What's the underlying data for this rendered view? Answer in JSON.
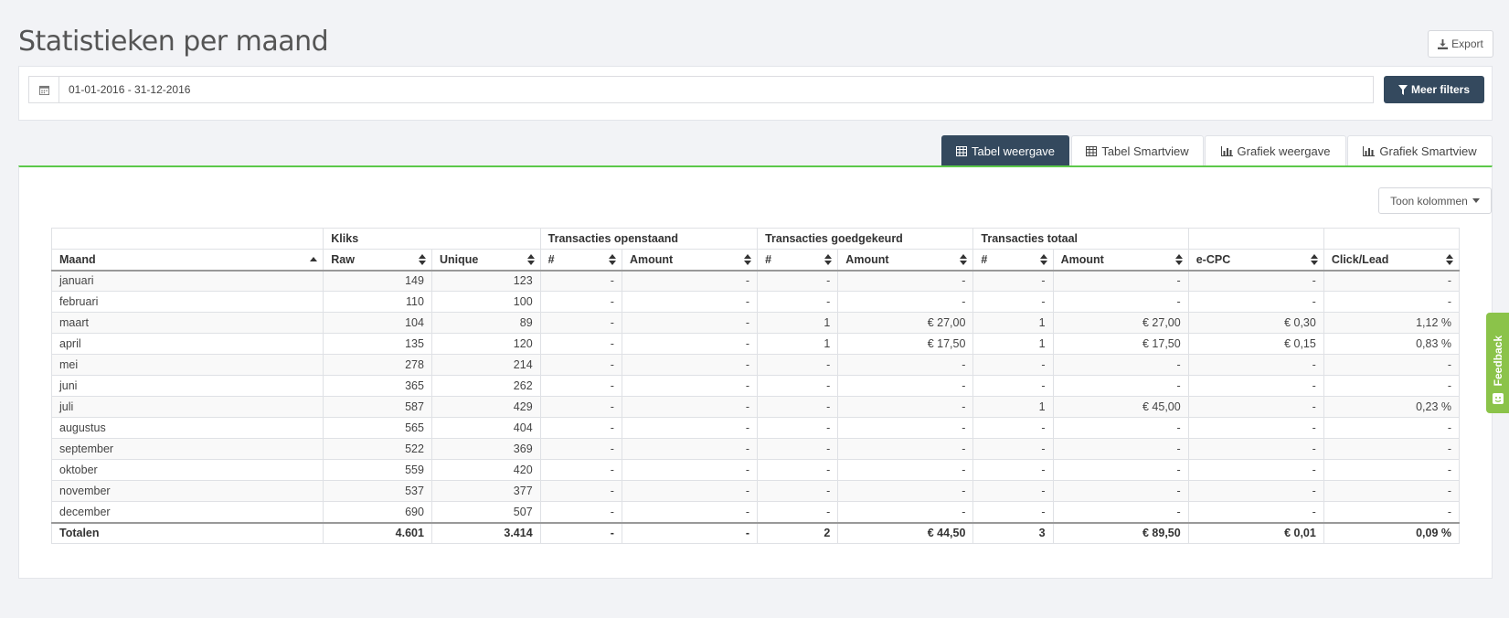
{
  "page": {
    "title": "Statistieken per maand"
  },
  "toolbar": {
    "export_label": "Export"
  },
  "filters": {
    "date_range": "01-01-2016 - 31-12-2016",
    "more_filters_label": "Meer filters"
  },
  "tabs": [
    {
      "label": "Tabel weergave",
      "icon": "table-icon",
      "active": true
    },
    {
      "label": "Tabel Smartview",
      "icon": "table-icon",
      "active": false
    },
    {
      "label": "Grafiek weergave",
      "icon": "bar-chart-icon",
      "active": false
    },
    {
      "label": "Grafiek Smartview",
      "icon": "bar-chart-icon",
      "active": false
    }
  ],
  "columns_button": {
    "label": "Toon kolommen"
  },
  "table": {
    "groups": {
      "kliks": "Kliks",
      "openstaand": "Transacties openstaand",
      "goedgekeurd": "Transacties goedgekeurd",
      "totaal": "Transacties totaal"
    },
    "headers": [
      "Maand",
      "Raw",
      "Unique",
      "#",
      "Amount",
      "#",
      "Amount",
      "#",
      "Amount",
      "e-CPC",
      "Click/Lead"
    ],
    "rows": [
      [
        "januari",
        "149",
        "123",
        "-",
        "-",
        "-",
        "-",
        "-",
        "-",
        "-",
        "-"
      ],
      [
        "februari",
        "110",
        "100",
        "-",
        "-",
        "-",
        "-",
        "-",
        "-",
        "-",
        "-"
      ],
      [
        "maart",
        "104",
        "89",
        "-",
        "-",
        "1",
        "€ 27,00",
        "1",
        "€ 27,00",
        "€ 0,30",
        "1,12 %"
      ],
      [
        "april",
        "135",
        "120",
        "-",
        "-",
        "1",
        "€ 17,50",
        "1",
        "€ 17,50",
        "€ 0,15",
        "0,83 %"
      ],
      [
        "mei",
        "278",
        "214",
        "-",
        "-",
        "-",
        "-",
        "-",
        "-",
        "-",
        "-"
      ],
      [
        "juni",
        "365",
        "262",
        "-",
        "-",
        "-",
        "-",
        "-",
        "-",
        "-",
        "-"
      ],
      [
        "juli",
        "587",
        "429",
        "-",
        "-",
        "-",
        "-",
        "1",
        "€ 45,00",
        "-",
        "0,23 %"
      ],
      [
        "augustus",
        "565",
        "404",
        "-",
        "-",
        "-",
        "-",
        "-",
        "-",
        "-",
        "-"
      ],
      [
        "september",
        "522",
        "369",
        "-",
        "-",
        "-",
        "-",
        "-",
        "-",
        "-",
        "-"
      ],
      [
        "oktober",
        "559",
        "420",
        "-",
        "-",
        "-",
        "-",
        "-",
        "-",
        "-",
        "-"
      ],
      [
        "november",
        "537",
        "377",
        "-",
        "-",
        "-",
        "-",
        "-",
        "-",
        "-",
        "-"
      ],
      [
        "december",
        "690",
        "507",
        "-",
        "-",
        "-",
        "-",
        "-",
        "-",
        "-",
        "-"
      ]
    ],
    "totals": [
      "Totalen",
      "4.601",
      "3.414",
      "-",
      "-",
      "2",
      "€ 44,50",
      "3",
      "€ 89,50",
      "€ 0,01",
      "0,09 %"
    ]
  },
  "feedback": {
    "label": "Feedback"
  },
  "colors": {
    "primary": "#34495e",
    "accent_green": "#5cc84a",
    "feedback_green": "#8bc34a"
  }
}
